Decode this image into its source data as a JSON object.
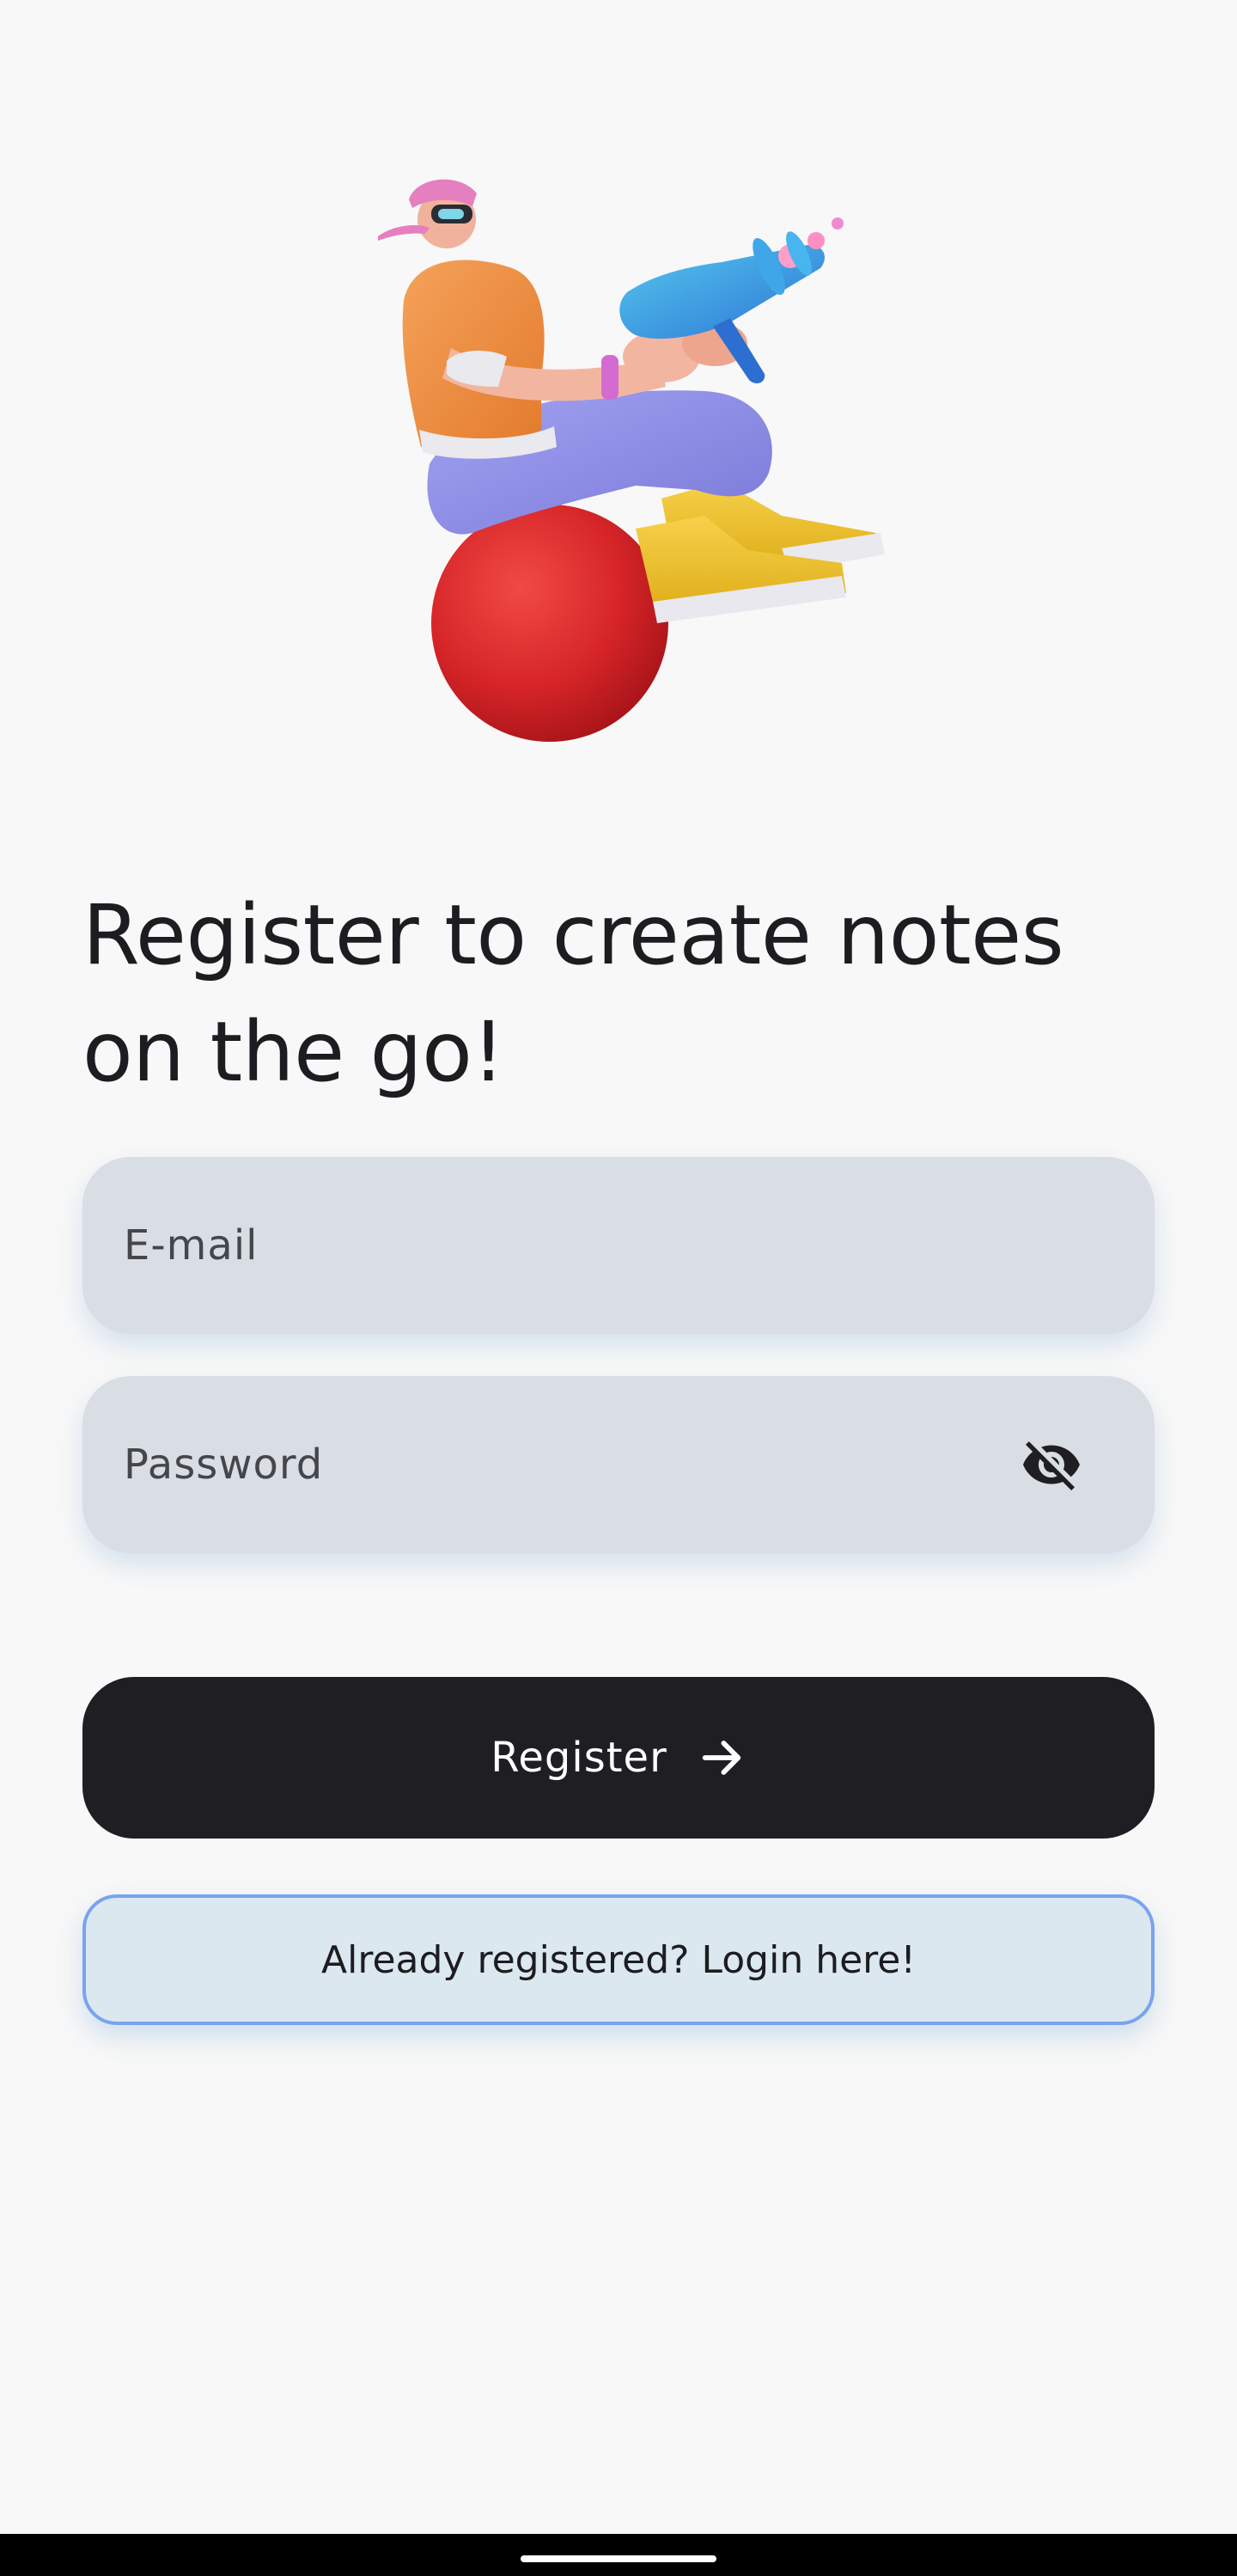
{
  "headline": "Register to create notes on the go!",
  "form": {
    "email_placeholder": "E-mail",
    "password_placeholder": "Password"
  },
  "buttons": {
    "register_label": "Register",
    "login_label": "Already registered? Login here!"
  },
  "icons": {
    "password_toggle": "eye-off-icon",
    "register_arrow": "arrow-right-icon"
  },
  "colors": {
    "background": "#f8f8f8",
    "field_fill": "#d9dde4",
    "primary_button": "#1f1f23",
    "secondary_button_fill": "#dbe8f0",
    "secondary_button_border": "#7aa3ee"
  }
}
